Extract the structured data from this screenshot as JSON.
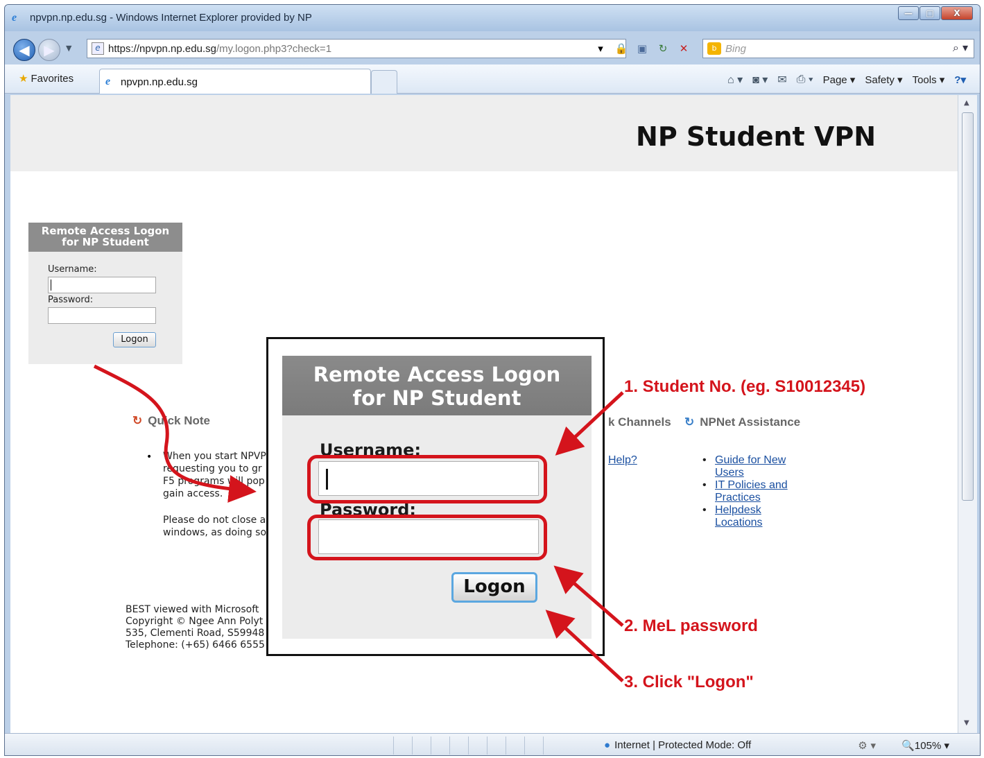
{
  "window": {
    "title": "npvpn.np.edu.sg - Windows Internet Explorer provided by NP",
    "controls": {
      "minimize": "—",
      "maximize": "□",
      "close": "X"
    }
  },
  "address_bar": {
    "url_base": "https://npvpn.np.edu.sg",
    "url_path": "/my.logon.php3?check=1",
    "search_placeholder": "Bing"
  },
  "favorites_bar": {
    "favorites_label": "Favorites",
    "tab_label": "npvpn.np.edu.sg"
  },
  "command_bar": {
    "page": "Page ▾",
    "safety": "Safety ▾",
    "tools": "Tools ▾",
    "help": "?▾"
  },
  "status_bar": {
    "zone": "Internet | Protected Mode: Off",
    "zoom": "105%"
  },
  "page": {
    "banner_title": "NP Student VPN",
    "login_small": {
      "header_line1": "Remote Access Logon",
      "header_line2": "for NP Student",
      "username_label": "Username:",
      "password_label": "Password:",
      "button": "Logon"
    },
    "quick_note": {
      "title": "Quick Note",
      "lines": [
        "When you start NPVPN",
        "requesting you to gr",
        "F5 programs will pop",
        "gain access."
      ],
      "para2_lines": [
        "Please do not close a",
        "windows, as doing so"
      ]
    },
    "channels_title": "k Channels",
    "help_link": "Help?",
    "assistance": {
      "title": "NPNet Assistance",
      "links": [
        [
          "Guide for New",
          "Users"
        ],
        [
          "IT Policies and",
          "Practices"
        ],
        [
          "Helpdesk",
          "Locations"
        ]
      ]
    },
    "footer": [
      "BEST viewed with Microsoft",
      "Copyright © Ngee Ann Polyt",
      "535, Clementi Road, S59948",
      "Telephone: (+65) 6466 6555"
    ]
  },
  "zoom_panel": {
    "header_line1": "Remote Access Logon",
    "header_line2": "for NP Student",
    "username_label": "Username:",
    "password_label": "Password:",
    "button": "Logon"
  },
  "annotations": {
    "step1": "1. Student No. (eg. S10012345)",
    "step2": "2. MeL password",
    "step3": "3. Click \"Logon\""
  },
  "colors": {
    "annotation_red": "#d4141c",
    "link_blue": "#1a4fa0",
    "header_gray": "#8d8d8d"
  }
}
